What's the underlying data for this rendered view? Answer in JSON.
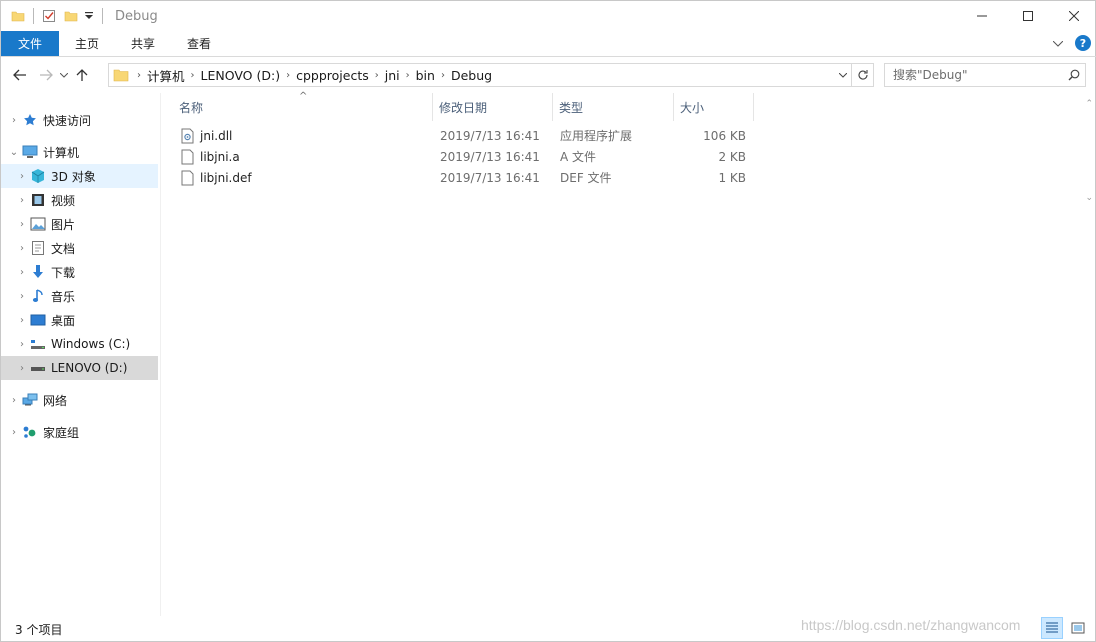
{
  "window": {
    "title": "Debug"
  },
  "ribbon": {
    "tabs": [
      "文件",
      "主页",
      "共享",
      "查看"
    ]
  },
  "address": {
    "crumbs": [
      "计算机",
      "LENOVO (D:)",
      "cppprojects",
      "jni",
      "bin",
      "Debug"
    ]
  },
  "search": {
    "placeholder": "搜索\"Debug\""
  },
  "sidebar": {
    "items": [
      {
        "label": "快速访问",
        "icon": "star-icon"
      },
      {
        "label": "计算机",
        "icon": "computer-icon"
      },
      {
        "label": "3D 对象",
        "icon": "cube-icon"
      },
      {
        "label": "视频",
        "icon": "video-icon"
      },
      {
        "label": "图片",
        "icon": "picture-icon"
      },
      {
        "label": "文档",
        "icon": "document-icon"
      },
      {
        "label": "下载",
        "icon": "download-icon"
      },
      {
        "label": "音乐",
        "icon": "music-icon"
      },
      {
        "label": "桌面",
        "icon": "desktop-icon"
      },
      {
        "label": "Windows (C:)",
        "icon": "windows-drive-icon"
      },
      {
        "label": "LENOVO (D:)",
        "icon": "drive-icon"
      },
      {
        "label": "网络",
        "icon": "network-icon"
      },
      {
        "label": "家庭组",
        "icon": "homegroup-icon"
      }
    ]
  },
  "columns": {
    "name": "名称",
    "date": "修改日期",
    "type": "类型",
    "size": "大小"
  },
  "files": [
    {
      "name": "jni.dll",
      "date": "2019/7/13 16:41",
      "type": "应用程序扩展",
      "size": "106 KB",
      "icon": "dll-file-icon"
    },
    {
      "name": "libjni.a",
      "date": "2019/7/13 16:41",
      "type": "A 文件",
      "size": "2 KB",
      "icon": "file-icon"
    },
    {
      "name": "libjni.def",
      "date": "2019/7/13 16:41",
      "type": "DEF 文件",
      "size": "1 KB",
      "icon": "file-icon"
    }
  ],
  "status": {
    "count": "3 个项目"
  },
  "watermark": "https://blog.csdn.net/zhangwancom",
  "colors": {
    "accent": "#1979ca",
    "hover": "#e5f3ff",
    "selected": "#d9d9d9"
  }
}
